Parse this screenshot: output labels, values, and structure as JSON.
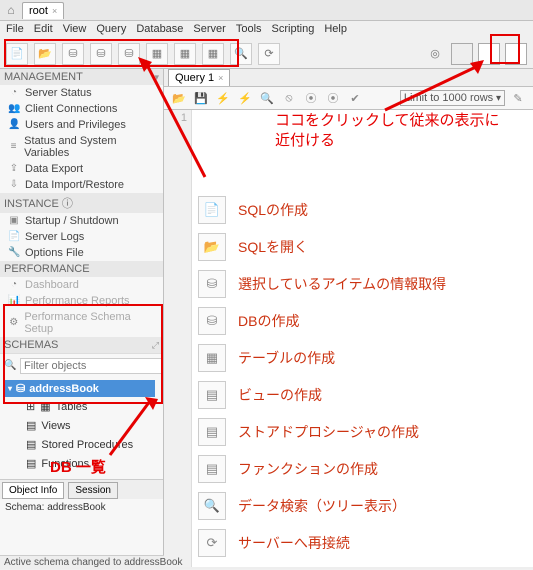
{
  "window": {
    "root_tab": "root",
    "close_x": "×"
  },
  "menu": [
    "File",
    "Edit",
    "View",
    "Query",
    "Database",
    "Server",
    "Tools",
    "Scripting",
    "Help"
  ],
  "toolbar_icons": [
    "sql+",
    "folder",
    "db-stack",
    "db-stack",
    "db-stack",
    "table",
    "table",
    "table",
    "search",
    "reconnect"
  ],
  "sidebar": {
    "management": {
      "header": "MANAGEMENT",
      "items": [
        {
          "icon": "◔",
          "label": "Server Status"
        },
        {
          "icon": "👥",
          "label": "Client Connections"
        },
        {
          "icon": "👤",
          "label": "Users and Privileges"
        },
        {
          "icon": "≡",
          "label": "Status and System Variables"
        },
        {
          "icon": "⇪",
          "label": "Data Export"
        },
        {
          "icon": "⇩",
          "label": "Data Import/Restore"
        }
      ]
    },
    "instance": {
      "header": "INSTANCE ⓘ",
      "items": [
        {
          "icon": "▣",
          "label": "Startup / Shutdown"
        },
        {
          "icon": "📄",
          "label": "Server Logs"
        },
        {
          "icon": "🔧",
          "label": "Options File"
        }
      ]
    },
    "performance": {
      "header": "PERFORMANCE",
      "items": [
        {
          "icon": "◔",
          "label": "Dashboard"
        },
        {
          "icon": "📊",
          "label": "Performance Reports"
        },
        {
          "icon": "⚙",
          "label": "Performance Schema Setup"
        }
      ]
    },
    "schemas": {
      "header": "SCHEMAS",
      "filter_placeholder": "Filter objects",
      "selected": "addressBook",
      "tree": [
        {
          "icon": "▦",
          "label": "Tables",
          "exp": "⊞"
        },
        {
          "icon": "▤",
          "label": "Views"
        },
        {
          "icon": "▤",
          "label": "Stored Procedures"
        },
        {
          "icon": "▤",
          "label": "Functions"
        }
      ]
    },
    "info_tabs": {
      "obj": "Object Info",
      "sess": "Session",
      "body": "Schema: addressBook"
    }
  },
  "query": {
    "tab": "Query 1",
    "row_limit": "Limit to 1000 rows",
    "gutter_num": "1",
    "actions": [
      "SQLの作成",
      "SQLを開く",
      "選択しているアイテムの情報取得",
      "DBの作成",
      "テーブルの作成",
      "ビューの作成",
      "ストアドプロシージャの作成",
      "ファンクションの作成",
      "データ検索（ツリー表示）",
      "サーバーへ再接続"
    ],
    "action_icons": [
      "SQL+",
      "SQL",
      "ⓘ",
      "⛁+",
      "▦+",
      "▤+",
      "{}+",
      "fx+",
      "🔍",
      "⟳"
    ]
  },
  "annotations": {
    "text1": "ココをクリックして従来の表示に\n近付ける",
    "text2": "DB 一覧"
  },
  "statusbar": "Active schema changed to addressBook"
}
